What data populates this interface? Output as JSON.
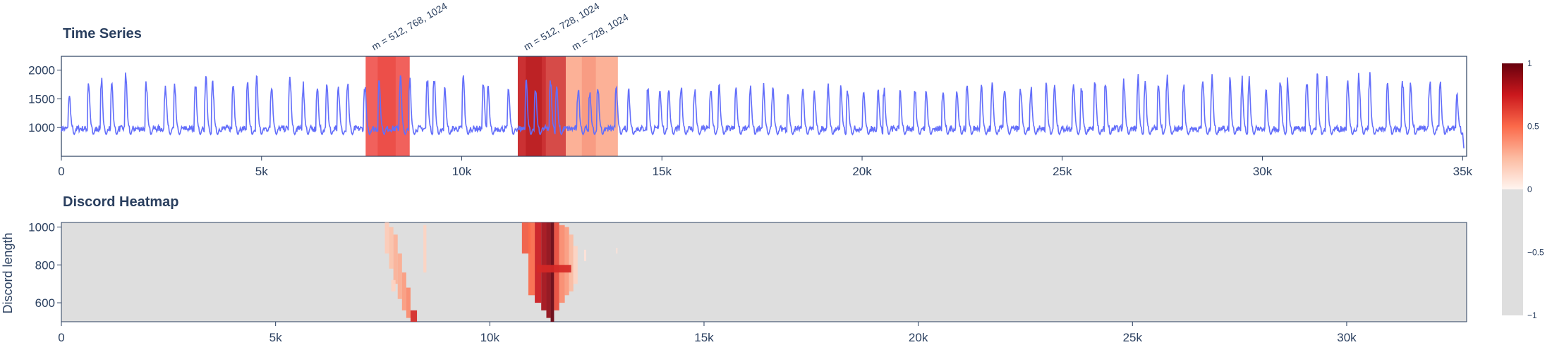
{
  "chart_data": [
    {
      "type": "line",
      "title": "Time Series",
      "xlim": [
        0,
        35100
      ],
      "ylim": [
        500,
        2240
      ],
      "x_ticks": [
        0,
        5000,
        10000,
        15000,
        20000,
        25000,
        30000,
        35000
      ],
      "x_tick_labels": [
        "0",
        "5k",
        "10k",
        "15k",
        "20k",
        "25k",
        "30k",
        "35k"
      ],
      "y_ticks": [
        1000,
        1500,
        2000
      ],
      "y_tick_labels": [
        "1000",
        "1500",
        "2000"
      ],
      "series": [
        {
          "color": "#636efa",
          "baseline": 1000,
          "spike_x": [
            200,
            680,
            1000,
            1260,
            1610,
            2120,
            2600,
            2830,
            3350,
            3610,
            3780,
            4290,
            4650,
            4880,
            5250,
            5710,
            6040,
            6390,
            6630,
            6920,
            7150,
            7580,
            7940,
            8470,
            8700,
            9140,
            9310,
            9580,
            10040,
            10540,
            10660,
            11170,
            11610,
            11840,
            12220,
            12370,
            12910,
            13200,
            13400,
            13860,
            14170,
            14650,
            14950,
            15170,
            15480,
            15820,
            16220,
            16430,
            16850,
            17210,
            17540,
            17770,
            18150,
            18520,
            18810,
            19150,
            19470,
            19640,
            20040,
            20400,
            20550,
            20950,
            21320,
            21600,
            22020,
            22370,
            22620,
            22980,
            23250,
            23560,
            23960,
            24220,
            24600,
            24810,
            25280,
            25480,
            25820,
            26080,
            26540,
            26890,
            27070,
            27400,
            27620,
            28030,
            28510,
            28740,
            29190,
            29490,
            29670,
            30090,
            30450,
            30630,
            31110,
            31370,
            31610,
            32130,
            32410,
            32680,
            33120,
            33500,
            33700,
            34180,
            34440,
            34860
          ],
          "spike_y": [
            1600,
            1900,
            1950,
            1800,
            2030,
            1900,
            1880,
            1800,
            1850,
            1990,
            1880,
            1950,
            1850,
            1960,
            1880,
            1990,
            1860,
            1830,
            1820,
            1830,
            1900,
            1850,
            1900,
            2000,
            1980,
            1940,
            2030,
            1820,
            2000,
            1870,
            1770,
            1810,
            1890,
            1800,
            1940,
            1800,
            1750,
            1700,
            1870,
            1830,
            1730,
            1860,
            1780,
            1750,
            1800,
            1750,
            1800,
            1790,
            1800,
            1780,
            1780,
            1770,
            1720,
            1750,
            1700,
            1810,
            1770,
            1770,
            1730,
            1770,
            1770,
            1720,
            1770,
            1800,
            1770,
            1760,
            1850,
            1780,
            1810,
            1830,
            1770,
            1780,
            1880,
            1830,
            1980,
            1830,
            1950,
            1940,
            1900,
            1960,
            1980,
            1860,
            2000,
            1850,
            1970,
            1960,
            1910,
            1950,
            1960,
            1800,
            1970,
            1940,
            1960,
            2000,
            1960,
            1990,
            2020,
            1980,
            1920,
            1940,
            1890,
            1970,
            1960,
            1610
          ]
        }
      ],
      "discord_regions": [
        {
          "x0": 7600,
          "x1": 8700,
          "label": "m = 512, 768, 1024",
          "color": "#f0504a"
        },
        {
          "x0": 11400,
          "x1": 12600,
          "label": "m = 512, 728, 1024",
          "color": "#c51b1d"
        },
        {
          "x0": 12600,
          "x1": 13900,
          "label": "m = 728, 1024",
          "color": "#fca98c"
        }
      ]
    },
    {
      "type": "heatmap",
      "title": "Discord Heatmap",
      "ylabel": "Discord length",
      "xlim": [
        0,
        32800
      ],
      "ylim": [
        500,
        1024
      ],
      "x_ticks": [
        0,
        5000,
        10000,
        15000,
        20000,
        25000,
        30000
      ],
      "x_tick_labels": [
        "0",
        "5k",
        "10k",
        "15k",
        "20k",
        "25k",
        "30k"
      ],
      "y_ticks": [
        600,
        800,
        1000
      ],
      "y_tick_labels": [
        "600",
        "800",
        "1000"
      ],
      "background_value": -1,
      "cells": [
        {
          "x0": 7550,
          "x1": 7650,
          "y0": 860,
          "y1": 1024,
          "v": 0.18
        },
        {
          "x0": 7650,
          "x1": 7750,
          "y0": 780,
          "y1": 1000,
          "v": 0.22
        },
        {
          "x0": 7750,
          "x1": 7850,
          "y0": 700,
          "y1": 960,
          "v": 0.28
        },
        {
          "x0": 7850,
          "x1": 7950,
          "y0": 620,
          "y1": 860,
          "v": 0.3
        },
        {
          "x0": 7950,
          "x1": 8050,
          "y0": 560,
          "y1": 760,
          "v": 0.35
        },
        {
          "x0": 8050,
          "x1": 8150,
          "y0": 520,
          "y1": 680,
          "v": 0.4
        },
        {
          "x0": 8150,
          "x1": 8300,
          "y0": 500,
          "y1": 560,
          "v": 0.7
        },
        {
          "x0": 7700,
          "x1": 7800,
          "y0": 660,
          "y1": 720,
          "v": 0.15
        },
        {
          "x0": 8450,
          "x1": 8520,
          "y0": 760,
          "y1": 1010,
          "v": 0.15
        },
        {
          "x0": 10750,
          "x1": 10950,
          "y0": 860,
          "y1": 1024,
          "v": 0.55
        },
        {
          "x0": 10900,
          "x1": 11050,
          "y0": 640,
          "y1": 1024,
          "v": 0.5
        },
        {
          "x0": 11050,
          "x1": 11200,
          "y0": 600,
          "y1": 1024,
          "v": 0.75
        },
        {
          "x0": 11200,
          "x1": 11320,
          "y0": 560,
          "y1": 1024,
          "v": 0.85
        },
        {
          "x0": 11320,
          "x1": 11420,
          "y0": 520,
          "y1": 1024,
          "v": 0.9
        },
        {
          "x0": 11420,
          "x1": 11500,
          "y0": 500,
          "y1": 1024,
          "v": 1.0
        },
        {
          "x0": 11500,
          "x1": 11620,
          "y0": 560,
          "y1": 1024,
          "v": 0.6
        },
        {
          "x0": 11620,
          "x1": 11750,
          "y0": 600,
          "y1": 1010,
          "v": 0.4
        },
        {
          "x0": 11750,
          "x1": 11850,
          "y0": 640,
          "y1": 1000,
          "v": 0.35
        },
        {
          "x0": 11850,
          "x1": 11950,
          "y0": 660,
          "y1": 960,
          "v": 0.25
        },
        {
          "x0": 11950,
          "x1": 12050,
          "y0": 700,
          "y1": 900,
          "v": 0.15
        },
        {
          "x0": 11100,
          "x1": 11900,
          "y0": 760,
          "y1": 800,
          "v": 0.7
        },
        {
          "x0": 12200,
          "x1": 12250,
          "y0": 820,
          "y1": 880,
          "v": 0.08
        },
        {
          "x0": 12950,
          "x1": 12980,
          "y0": 860,
          "y1": 890,
          "v": 0.08
        }
      ],
      "colorscale": {
        "zmin": -1,
        "zmax": 1,
        "ticks": [
          -1,
          -0.5,
          0,
          0.5,
          1
        ],
        "tick_labels": [
          "−1",
          "−0.5",
          "0",
          "0.5",
          "1"
        ],
        "stops": [
          {
            "v": -1,
            "color": "#dedede"
          },
          {
            "v": 0,
            "color": "#dedede"
          },
          {
            "v": 0.0001,
            "color": "#fff5f0"
          },
          {
            "v": 0.25,
            "color": "#fcbba1"
          },
          {
            "v": 0.5,
            "color": "#fb6a4a"
          },
          {
            "v": 0.75,
            "color": "#cb181d"
          },
          {
            "v": 1,
            "color": "#67000d"
          }
        ]
      }
    }
  ]
}
